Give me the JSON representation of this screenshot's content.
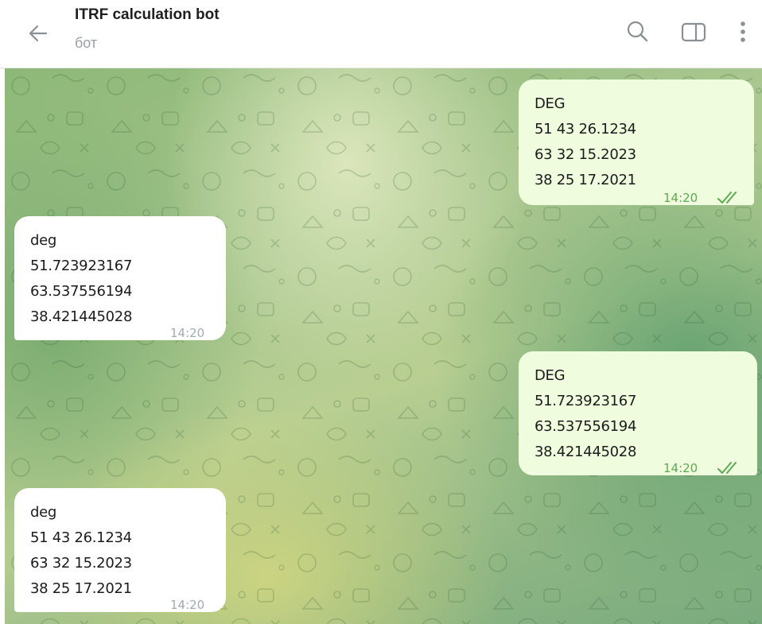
{
  "header": {
    "title": "ITRF calculation bot",
    "subtitle": "бот",
    "icons": [
      "arrow-back-icon",
      "search-icon",
      "sidebar-toggle-icon",
      "more-vertical-icon"
    ]
  },
  "messages": [
    {
      "direction": "outgoing",
      "text": "DEG\n51 43 26.1234\n63 32 15.2023\n38 25 17.2021",
      "time": "14:20",
      "status": "read"
    },
    {
      "direction": "incoming",
      "text": "deg\n51.723923167\n63.537556194\n38.421445028",
      "time": "14:20"
    },
    {
      "direction": "outgoing",
      "text": "DEG\n51.723923167\n63.537556194\n38.421445028",
      "time": "14:20",
      "status": "read"
    },
    {
      "direction": "incoming",
      "text": "deg\n51 43 26.1234\n63 32 15.2023\n38 25 17.2021",
      "time": "14:20"
    }
  ],
  "colors": {
    "outgoing_bubble": "#effdde",
    "incoming_bubble": "#ffffff",
    "outgoing_time": "#5caa51",
    "incoming_time": "#a0acb6",
    "read_checks": "#5caa51"
  }
}
